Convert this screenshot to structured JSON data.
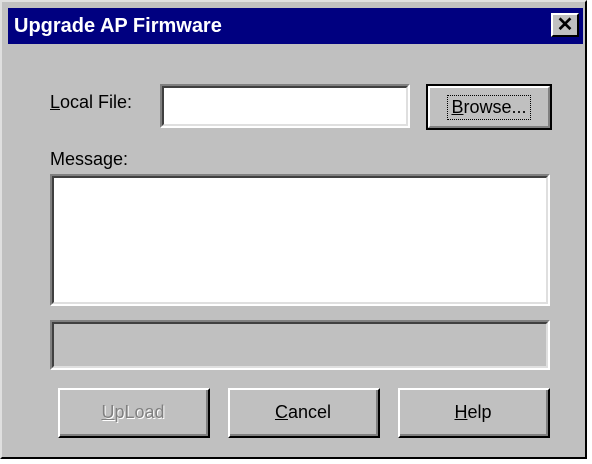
{
  "window": {
    "title": "Upgrade AP Firmware",
    "close_glyph": "✕"
  },
  "local_file": {
    "label_mnemonic": "L",
    "label_rest": "ocal File:",
    "value": "",
    "placeholder": ""
  },
  "browse_button": {
    "mnemonic": "B",
    "rest": "rowse..."
  },
  "message": {
    "label": "Message:",
    "value": ""
  },
  "progress": {
    "value": 0
  },
  "buttons": {
    "upload": {
      "mnemonic": "U",
      "rest": "pLoad",
      "enabled": false
    },
    "cancel": {
      "mnemonic": "C",
      "rest": "ancel"
    },
    "help": {
      "mnemonic": "H",
      "rest": "elp"
    }
  },
  "colors": {
    "title_bar": "#000080",
    "face": "#c0c0c0"
  }
}
